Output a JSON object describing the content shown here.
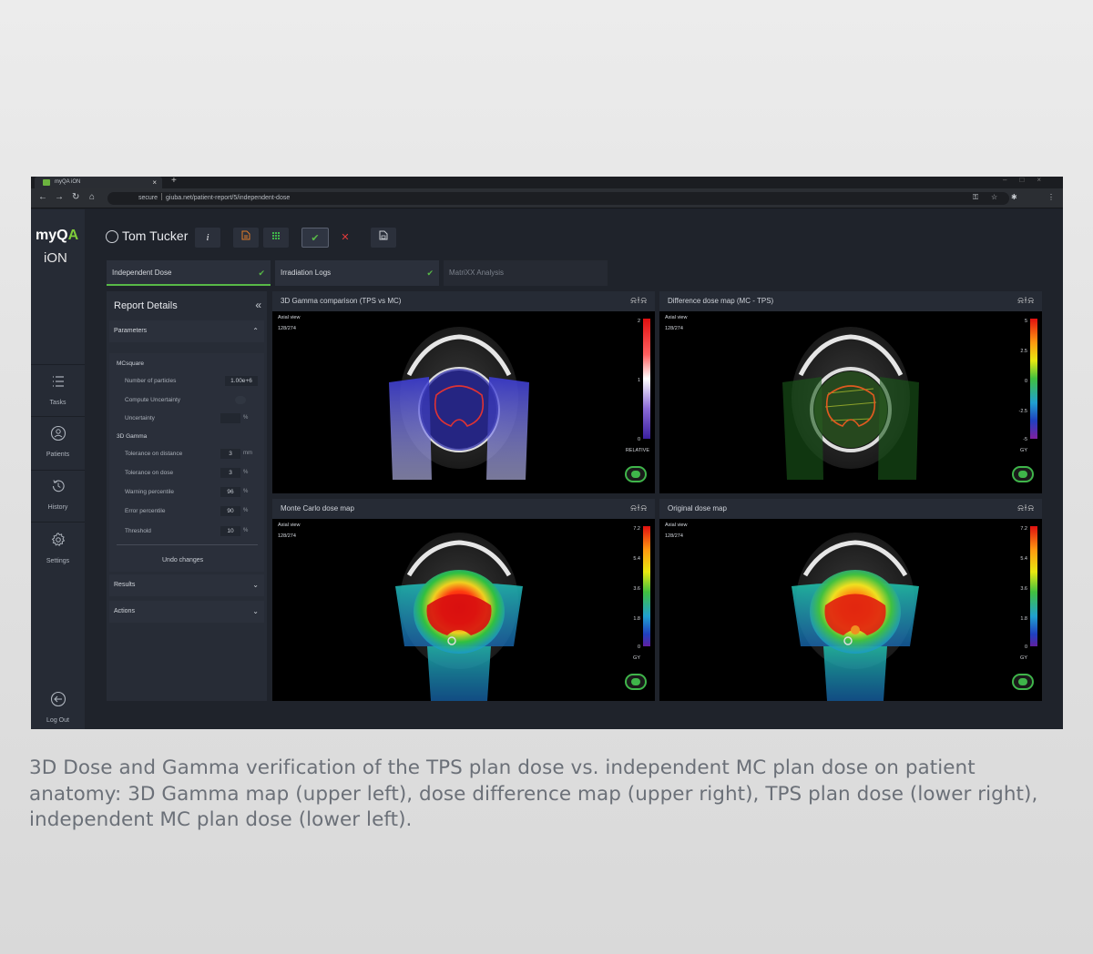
{
  "browser": {
    "tab_title": "myQA iON",
    "new_tab": "+",
    "url_secure": "secure",
    "url": "giuba.net/patient-report/5/independent-dose"
  },
  "app": {
    "logo_top": "myQA",
    "logo_bottom": "iON",
    "accent_color": "#7fcc3a",
    "sidebar": [
      {
        "label": "Tasks",
        "icon": "list-icon"
      },
      {
        "label": "Patients",
        "icon": "patients-icon"
      },
      {
        "label": "History",
        "icon": "history-icon"
      },
      {
        "label": "Settings",
        "icon": "gear-icon"
      }
    ],
    "logout_label": "Log Out",
    "patient_name": "Tom Tucker",
    "info_label": "i",
    "tabs": [
      {
        "label": "Independent Dose",
        "checked": true
      },
      {
        "label": "Irradiation Logs",
        "checked": true
      },
      {
        "label": "MatriXX Analysis",
        "checked": false
      }
    ],
    "report": {
      "title": "Report Details",
      "parameters_label": "Parameters",
      "mcsquare_label": "MCsquare",
      "number_of_particles_label": "Number of particles",
      "number_of_particles_value": "1.00e+6",
      "compute_uncertainty_label": "Compute Uncertainty",
      "uncertainty_label": "Uncertainty",
      "uncertainty_unit": "%",
      "gamma_label": "3D Gamma",
      "tol_distance_label": "Tolerance on distance",
      "tol_distance_value": "3",
      "tol_distance_unit": "mm",
      "tol_dose_label": "Tolerance on dose",
      "tol_dose_value": "3",
      "tol_dose_unit": "%",
      "warning_label": "Warning percentile",
      "warning_value": "96",
      "warning_unit": "%",
      "error_label": "Error percentile",
      "error_value": "90",
      "error_unit": "%",
      "threshold_label": "Threshold",
      "threshold_value": "10",
      "threshold_unit": "%",
      "undo_label": "Undo changes",
      "results_label": "Results",
      "actions_label": "Actions"
    },
    "viewports": [
      {
        "title": "3D Gamma comparison (TPS vs MC)",
        "view": "Axial view",
        "slice": "128/274",
        "ticks": [
          "2",
          "1",
          "0"
        ],
        "unit": "RELATIVE"
      },
      {
        "title": "Difference dose map (MC - TPS)",
        "view": "Axial view",
        "slice": "128/274",
        "ticks": [
          "5",
          "2.5",
          "0",
          "-2.5",
          "-5"
        ],
        "unit": "GY"
      },
      {
        "title": "Monte Carlo dose map",
        "view": "Axial view",
        "slice": "128/274",
        "ticks": [
          "7.2",
          "5.4",
          "3.6",
          "1.8",
          "0"
        ],
        "unit": "GY"
      },
      {
        "title": "Original dose map",
        "view": "Axial view",
        "slice": "128/274",
        "ticks": [
          "7.2",
          "5.4",
          "3.6",
          "1.8",
          "0"
        ],
        "unit": "GY"
      }
    ]
  },
  "caption": "3D Dose and Gamma verification of the TPS plan dose vs. independent MC plan dose on patient anatomy: 3D Gamma map (upper left), dose difference map (upper right), TPS plan dose (lower right), independent MC plan dose (lower left)."
}
